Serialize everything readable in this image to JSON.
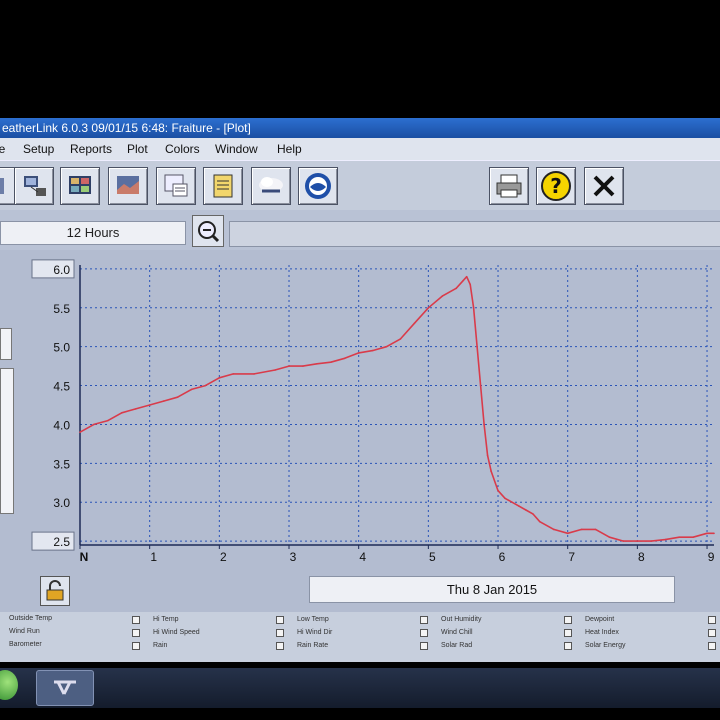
{
  "window": {
    "title": "eatherLink 6.0.3  09/01/15   6:48: Fraiture - [Plot]"
  },
  "menu": [
    "le",
    "Setup",
    "Reports",
    "Plot",
    "Colors",
    "Window",
    "Help"
  ],
  "toolbar": {
    "buttons": [
      "app-icon",
      "station-icon",
      "data-icon",
      "image-icon",
      "summary-icon",
      "notepad-icon",
      "weather-icon",
      "noaa-icon",
      "print-icon",
      "help-icon",
      "close-icon"
    ]
  },
  "range": {
    "label": "12 Hours"
  },
  "date_label": "Thu 8 Jan 2015",
  "chart_data": {
    "type": "line",
    "title": "",
    "xlabel": "",
    "ylabel": "",
    "xlim": [
      0,
      9.1
    ],
    "ylim": [
      2.45,
      6.05
    ],
    "y_ticks": [
      "6.0",
      "5.5",
      "5.0",
      "4.5",
      "4.0",
      "3.5",
      "3.0",
      "2.5"
    ],
    "y_tick_values": [
      6.0,
      5.5,
      5.0,
      4.5,
      4.0,
      3.5,
      3.0,
      2.5
    ],
    "x_ticks": [
      "N",
      "1",
      "2",
      "3",
      "4",
      "5",
      "6",
      "7",
      "8",
      "9"
    ],
    "x_tick_values": [
      0,
      1,
      2,
      3,
      4,
      5,
      6,
      7,
      8,
      9
    ],
    "grid": true,
    "line_color": "#d93b4a",
    "series": [
      {
        "x": [
          0,
          0.2,
          0.4,
          0.6,
          0.8,
          1.0,
          1.2,
          1.4,
          1.6,
          1.8,
          2.0,
          2.2,
          2.5,
          2.8,
          3.0,
          3.2,
          3.4,
          3.6,
          3.8,
          4.0,
          4.2,
          4.4,
          4.6,
          4.8,
          5.0,
          5.2,
          5.4,
          5.5,
          5.55,
          5.6,
          5.65,
          5.7,
          5.75,
          5.8,
          5.85,
          5.9,
          6.0,
          6.1,
          6.2,
          6.3,
          6.4,
          6.5,
          6.6,
          6.8,
          7.0,
          7.2,
          7.4,
          7.6,
          7.8,
          8.0,
          8.2,
          8.4,
          8.6,
          8.8,
          9.0,
          9.1
        ],
        "y": [
          3.9,
          4.0,
          4.05,
          4.15,
          4.2,
          4.25,
          4.3,
          4.35,
          4.45,
          4.5,
          4.6,
          4.65,
          4.65,
          4.7,
          4.75,
          4.75,
          4.78,
          4.8,
          4.85,
          4.92,
          4.95,
          5.0,
          5.1,
          5.3,
          5.5,
          5.65,
          5.75,
          5.85,
          5.9,
          5.8,
          5.5,
          5.0,
          4.5,
          4.0,
          3.6,
          3.4,
          3.15,
          3.05,
          3.0,
          2.95,
          2.9,
          2.85,
          2.75,
          2.65,
          2.6,
          2.65,
          2.65,
          2.55,
          2.5,
          2.5,
          2.5,
          2.52,
          2.55,
          2.55,
          2.6,
          2.6
        ]
      }
    ]
  },
  "legend": {
    "col1": [
      "Outside Temp",
      "Wind Run",
      "Barometer"
    ],
    "col2": [
      "Hi Temp",
      "Hi Wind Speed",
      "Rain"
    ],
    "col3": [
      "Low Temp",
      "Hi Wind Dir",
      "Rain Rate"
    ],
    "col4": [
      "Out Humidity",
      "Wind Chill",
      "Solar Rad"
    ],
    "col5": [
      "Dewpoint",
      "Heat Index",
      "Solar Energy"
    ]
  },
  "colors": {
    "plot_bg": "#b3bcd0",
    "line": "#d93b4a",
    "grid": "#2a54b8"
  }
}
